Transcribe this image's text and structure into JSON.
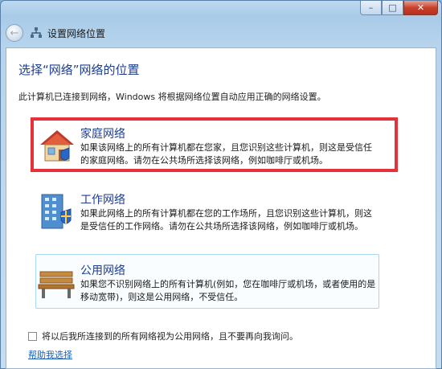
{
  "window": {
    "title": "设置网络位置",
    "caption_buttons": {
      "minimize": "–",
      "maximize": "□",
      "close": "✕"
    },
    "back_icon": "back-arrow-icon"
  },
  "main": {
    "heading": "选择“网络”网络的位置",
    "description": "此计算机已连接到网络，Windows 将根据网络位置自动应用正确的网络设置。",
    "options": [
      {
        "icon": "home-network-icon",
        "title": "家庭网络",
        "description": "如果该网络上的所有计算机都在您家，且您识别这些计算机，则这是受信任的家庭网络。请勿在公共场所选择该网络，例如咖啡厅或机场。"
      },
      {
        "icon": "work-network-icon",
        "title": "工作网络",
        "description": "如果此网络上的所有计算机都在您的工作场所，且您识别这些计算机，则这是受信任的工作网络。请勿在公共场所选择该网络，例如咖啡厅或机场。"
      },
      {
        "icon": "public-network-icon",
        "title": "公用网络",
        "description": "如果您不识别网络上的所有计算机(例如，您在咖啡厅或机场，或者使用的是移动宽带)，则这是公用网络，不受信任。"
      }
    ],
    "checkbox_label": "将以后我所连接到的所有网络视为公用网络，且不要再向我询问。",
    "checkbox_checked": false,
    "help_link": "帮助我选择"
  },
  "colors": {
    "heading": "#1e3d8f",
    "highlight": "#e5323a",
    "link": "#1a5fb4"
  }
}
